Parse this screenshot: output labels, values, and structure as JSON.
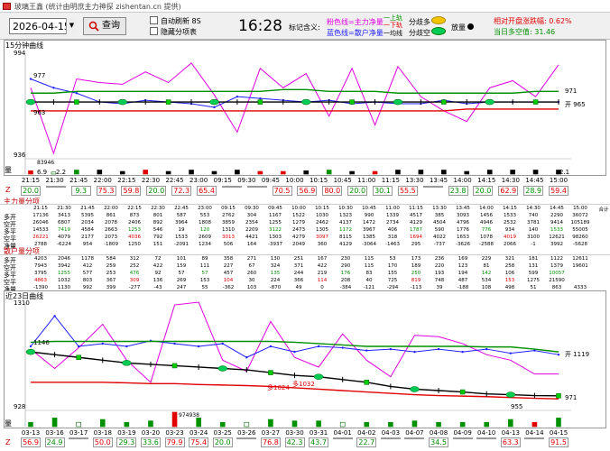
{
  "window": {
    "title": "玻璃王鑫 (统计由明庶主力神探 zishentan.cn 提供)"
  },
  "toolbar": {
    "date": "2026-04-15",
    "query_label": "查询",
    "auto_refresh_label": "自动刷新 8S",
    "hide_table_label": "隐藏分项表",
    "time": "16:28",
    "indicator_label": "标记含义:",
    "pink_legend": "粉色线=主力净量",
    "blue_legend": "蓝色线=散户净量",
    "green_up": "一上轨",
    "red_down": "一下轨",
    "black_line": "一均线",
    "up_split": "分歧多",
    "down_split": "分歧空",
    "pos_label": "放量",
    "stat1": "相对开盘涨跌幅: 0.62%",
    "stat2": "当日多空值: 31.46"
  },
  "chart15": {
    "title": "15分钟曲线",
    "y_top": "994",
    "y_bottom": "936",
    "label_977": "977",
    "label_963": "963",
    "right_971": "971",
    "right_open": "开 965",
    "vol_label": "量",
    "vol_value": "83946",
    "vol_69": "6.9",
    "vol_22": "2.2",
    "vol_21": "2.1"
  },
  "times15": [
    "21:15",
    "21:30",
    "21:45",
    "22:00",
    "22:15",
    "22:30",
    "22:45",
    "23:00",
    "09:15",
    "09:30",
    "09:45",
    "10:00",
    "10:15",
    "10:45",
    "11:00",
    "11:15",
    "13:30",
    "13:45",
    "14:00",
    "14:15",
    "14:30",
    "14:45",
    "15:00"
  ],
  "vals15": [
    "20.0",
    "",
    "9.3",
    "75.3",
    "59.8",
    "20.0",
    "72.3",
    "65.4",
    "",
    "",
    "70.5",
    "56.9",
    "80.0",
    "20.0",
    "30.1",
    "55.5",
    "",
    "23.8",
    "20.0",
    "62.9",
    "28.9",
    "59.4"
  ],
  "vals15_colors": [
    "#009000",
    "#009000",
    "#009000",
    "#e00000",
    "#e00000",
    "#009000",
    "#e00000",
    "#e00000",
    "#009000",
    "#009000",
    "#e00000",
    "#e00000",
    "#e00000",
    "#009000",
    "#009000",
    "#e00000",
    "#009000",
    "#009000",
    "#009000",
    "#e00000",
    "#009000",
    "#e00000"
  ],
  "main_table": {
    "title": "主力量分项",
    "header": [
      "21:15",
      "21:30",
      "21:45",
      "22:00",
      "22:15",
      "22:30",
      "22:45",
      "23:00",
      "09:15",
      "09:30",
      "09:45",
      "10:00",
      "10:15",
      "10:30",
      "10:45",
      "11:00",
      "11:15",
      "13:30",
      "13:45",
      "14:00",
      "14:15",
      "14:30",
      "14:45",
      "15:00",
      "合计"
    ],
    "rows": [
      {
        "label": "多开",
        "values": [
          "17136",
          "3413",
          "5395",
          "861",
          "873",
          "801",
          "587",
          "553",
          "2762",
          "304",
          "1167",
          "1522",
          "1030",
          "1323",
          "990",
          "1339",
          "4517",
          "385",
          "3093",
          "1456",
          "1533",
          "740",
          "2290",
          "36072"
        ]
      },
      {
        "label": "空开",
        "values": [
          "26046",
          "6807",
          "2034",
          "2078",
          "2406",
          "892",
          "3964",
          "1808",
          "3859",
          "2354",
          "1255",
          "1279",
          "2462",
          "4137",
          "1472",
          "2734",
          "4129",
          "4504",
          "4796",
          "4946",
          "2532",
          "3781",
          "9414",
          "105189"
        ]
      },
      {
        "label": "多平",
        "values": [
          "14533",
          "7419",
          "4584",
          "2663",
          "1253",
          "546",
          "19",
          "120",
          "1310",
          "2209",
          "3122",
          "2473",
          "1305",
          "1172",
          "3967",
          "406",
          "1787",
          "590",
          "1776",
          "776",
          "934",
          "140",
          "1533",
          "55005"
        ]
      },
      {
        "label": "空平",
        "values": [
          "26221",
          "4079",
          "2177",
          "2073",
          "4036",
          "792",
          "1533",
          "2609",
          "3013",
          "4421",
          "1303",
          "4279",
          "3097",
          "8115",
          "1385",
          "318",
          "1694",
          "4022",
          "1653",
          "1078",
          "4019",
          "3100",
          "12621",
          "98260"
        ]
      },
      {
        "label": "净量",
        "values": [
          "2788",
          "-6224",
          "954",
          "-1809",
          "1250",
          "151",
          "-2091",
          "1234",
          "506",
          "164",
          "-3937",
          "2049",
          "360",
          "4129",
          "-3064",
          "-1463",
          "295",
          "-737",
          "-3626",
          "-2588",
          "2066",
          "-1",
          "3992",
          "-5628"
        ]
      }
    ]
  },
  "retail_table": {
    "title": "散户量分项",
    "rows": [
      {
        "label": "多开",
        "values": [
          "4203",
          "2046",
          "1178",
          "584",
          "312",
          "72",
          "101",
          "89",
          "358",
          "271",
          "130",
          "251",
          "167",
          "230",
          "115",
          "53",
          "173",
          "236",
          "169",
          "229",
          "321",
          "181",
          "1122",
          "12611"
        ]
      },
      {
        "label": "空开",
        "values": [
          "7943",
          "3942",
          "412",
          "259",
          "252",
          "422",
          "159",
          "111",
          "227",
          "67",
          "324",
          "371",
          "422",
          "290",
          "115",
          "170",
          "189",
          "220",
          "123",
          "81",
          "258",
          "131",
          "1379",
          "19601"
        ]
      },
      {
        "label": "多平",
        "values": [
          "3795",
          "1255",
          "577",
          "253",
          "476",
          "92",
          "57",
          "57",
          "457",
          "260",
          "135",
          "244",
          "219",
          "176",
          "83",
          "155",
          "250",
          "193",
          "194",
          "142",
          "106",
          "599",
          "10057"
        ]
      },
      {
        "label": "空平",
        "values": [
          "4863",
          "1032",
          "803",
          "367",
          "309",
          "136",
          "269",
          "153",
          "104",
          "30",
          "224",
          "366",
          "114",
          "208",
          "40",
          "725",
          "819",
          "748",
          "487",
          "534",
          "153",
          "1275",
          "21590"
        ]
      },
      {
        "label": "净量",
        "values": [
          "-1390",
          "1130",
          "992",
          "399",
          "-277",
          "-43",
          "247",
          "55",
          "-362",
          "103",
          "-870",
          "49",
          "0",
          "-384",
          "-121",
          "-294",
          "-113",
          "39",
          "-188",
          "108",
          "498",
          "51",
          "863",
          "4333"
        ]
      }
    ]
  },
  "chart23": {
    "title": "近23日曲线",
    "y_top": "1310",
    "y_1146": "1146",
    "y_bottom": "928",
    "right_open": "开 1119",
    "right_971": "971",
    "label_955": "955",
    "annot1": "多1024",
    "annot2": "多1032",
    "vol_label": "量",
    "vol_value": "974938"
  },
  "dates23": [
    "03-13",
    "03-16",
    "03-17",
    "03-18",
    "03-19",
    "03-20",
    "03-23",
    "03-24",
    "03-25",
    "03-26",
    "03-27",
    "03-30",
    "03-31",
    "04-01",
    "04-02",
    "04-03",
    "04-07",
    "04-08",
    "04-09",
    "04-10",
    "04-13",
    "04-14",
    "04-15"
  ],
  "vals23": [
    "56.9",
    "24.9",
    "",
    "50.0",
    "29.3",
    "33.6",
    "79.9",
    "75.4",
    "20.0",
    "",
    "76.8",
    "42.3",
    "43.7",
    "",
    "22.7",
    "",
    "",
    "34.5",
    "",
    "",
    "63.3",
    "",
    "91.5"
  ],
  "vals23_colors": [
    "#e00000",
    "#009000",
    "#009000",
    "#e00000",
    "#009000",
    "#009000",
    "#e00000",
    "#e00000",
    "#009000",
    "#009000",
    "#e00000",
    "#009000",
    "#009000",
    "#009000",
    "#009000",
    "#009000",
    "#009000",
    "#009000",
    "#009000",
    "#009000",
    "#e00000",
    "#009000",
    "#e00000"
  ],
  "chart_data": [
    {
      "type": "line",
      "title": "15分钟曲线",
      "ylim": [
        936,
        994
      ],
      "x": [
        "21:15",
        "21:30",
        "21:45",
        "22:00",
        "22:15",
        "22:30",
        "22:45",
        "23:00",
        "09:15",
        "09:30",
        "09:45",
        "10:00",
        "10:15",
        "10:30",
        "10:45",
        "11:00",
        "11:15",
        "13:30",
        "13:45",
        "14:00",
        "14:15",
        "14:30",
        "14:45",
        "15:00"
      ],
      "series": [
        {
          "name": "主力净量",
          "color": "#e000e0",
          "values": [
            975,
            938,
            980,
            978,
            977,
            984,
            978,
            989,
            971,
            950,
            986,
            975,
            983,
            959,
            986,
            954,
            987,
            970,
            962,
            956,
            975,
            979,
            970,
            988
          ]
        },
        {
          "name": "散户净量",
          "color": "#2020ff",
          "values": [
            980,
            975,
            972,
            967,
            966,
            968,
            967,
            966,
            964,
            970,
            969,
            968,
            967,
            968,
            966,
            967,
            966,
            966,
            968,
            966,
            967,
            967,
            967,
            967
          ]
        },
        {
          "name": "上轨",
          "color": "#009000",
          "values": [
            972,
            972,
            973,
            973,
            973,
            973,
            973,
            973,
            973,
            973,
            973,
            974,
            974,
            973,
            973,
            973,
            972,
            972,
            972,
            972,
            972,
            972,
            973,
            973
          ]
        },
        {
          "name": "下轨",
          "color": "#e00000",
          "values": [
            962,
            962,
            962,
            962,
            962,
            962,
            962,
            962,
            962,
            962,
            962,
            962,
            962,
            962,
            962,
            962,
            962,
            962,
            962,
            963,
            963,
            963,
            963,
            963
          ]
        },
        {
          "name": "均线",
          "color": "#000000",
          "values": [
            967,
            967,
            967,
            967,
            967,
            967,
            967,
            967,
            967,
            967,
            967,
            967,
            967,
            967,
            967,
            967,
            967,
            967,
            967,
            967,
            967,
            967,
            967,
            967
          ]
        }
      ]
    },
    {
      "type": "line",
      "title": "近23日曲线",
      "ylim": [
        928,
        1310
      ],
      "x": [
        "03-13",
        "03-16",
        "03-17",
        "03-18",
        "03-19",
        "03-20",
        "03-23",
        "03-24",
        "03-25",
        "03-26",
        "03-27",
        "03-30",
        "03-31",
        "04-01",
        "04-02",
        "04-03",
        "04-07",
        "04-08",
        "04-09",
        "04-10",
        "04-13",
        "04-14",
        "04-15"
      ],
      "series": [
        {
          "name": "主力净量",
          "color": "#e000e0",
          "values": [
            1140,
            1070,
            1145,
            1230,
            1100,
            1020,
            1300,
            1310,
            1100,
            1060,
            1240,
            1110,
            1075,
            1195,
            1100,
            1040,
            1190,
            1185,
            1160,
            1120,
            1100,
            1050,
            1050
          ]
        },
        {
          "name": "散户净量",
          "color": "#2020ff",
          "values": [
            1150,
            1260,
            1150,
            1160,
            1150,
            1170,
            1160,
            1150,
            1160,
            1110,
            1150,
            1130,
            1150,
            1145,
            1135,
            1140,
            1130,
            1140,
            1130,
            1140,
            1125,
            1135,
            1120
          ]
        },
        {
          "name": "上轨",
          "color": "#009000",
          "values": [
            1165,
            1168,
            1168,
            1168,
            1168,
            1168,
            1168,
            1168,
            1168,
            1168,
            1168,
            1165,
            1160,
            1155,
            1150,
            1150,
            1150,
            1150,
            1150,
            1148,
            1148,
            1140,
            1130
          ]
        },
        {
          "name": "下轨",
          "color": "#e00000",
          "values": [
            1020,
            1020,
            1020,
            1020,
            1018,
            1015,
            1015,
            1012,
            1010,
            1008,
            1005,
            1000,
            995,
            990,
            985,
            980,
            975,
            972,
            970,
            968,
            965,
            962,
            960
          ]
        },
        {
          "name": "均线",
          "color": "#000000",
          "values": [
            1130,
            1120,
            1110,
            1100,
            1090,
            1085,
            1080,
            1075,
            1070,
            1065,
            1055,
            1045,
            1040,
            1030,
            1020,
            1005,
            995,
            990,
            985,
            978,
            975,
            972,
            971
          ]
        }
      ]
    }
  ]
}
